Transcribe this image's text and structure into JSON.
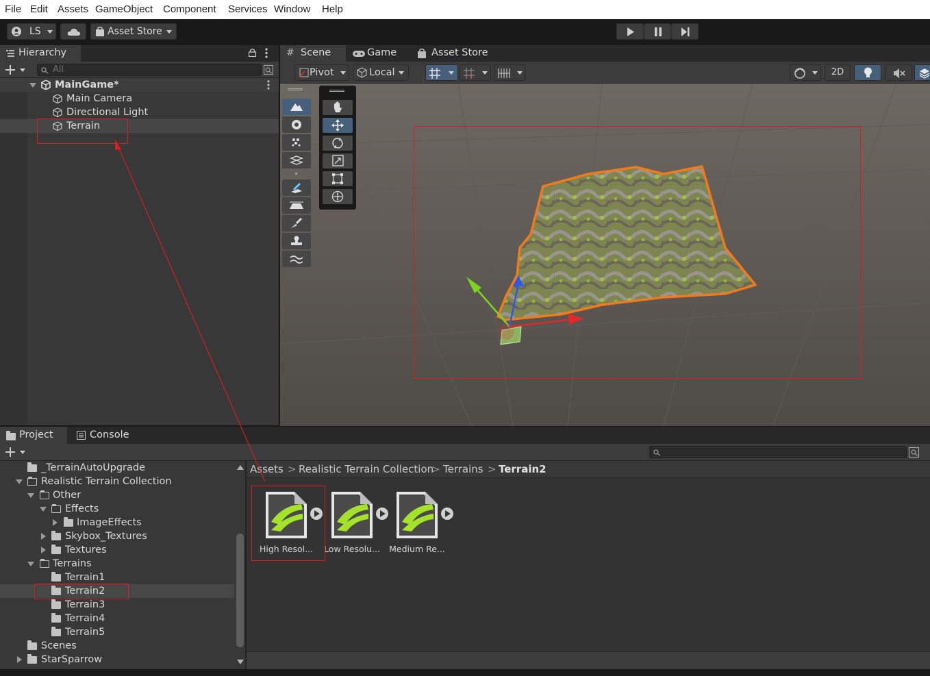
{
  "menu": [
    "File",
    "Edit",
    "Assets",
    "GameObject",
    "Component",
    "Services",
    "Window",
    "Help"
  ],
  "toolbar": {
    "account": "LS",
    "asset_store": "Asset Store"
  },
  "hierarchy": {
    "tab": "Hierarchy",
    "search_placeholder": "All",
    "scene": "MainGame*",
    "items": [
      "Main Camera",
      "Directional Light",
      "Terrain"
    ]
  },
  "scene_view": {
    "tabs": [
      "Scene",
      "Game",
      "Asset Store"
    ],
    "pivot": "Pivot",
    "local": "Local",
    "mode_2d": "2D"
  },
  "project": {
    "tabs": [
      "Project",
      "Console"
    ],
    "tree": [
      {
        "label": "_TerrainAutoUpgrade"
      },
      {
        "label": "Realistic Terrain Collection"
      },
      {
        "label": "Other"
      },
      {
        "label": "Effects"
      },
      {
        "label": "ImageEffects"
      },
      {
        "label": "Skybox_Textures"
      },
      {
        "label": "Textures"
      },
      {
        "label": "Terrains"
      },
      {
        "label": "Terrain1"
      },
      {
        "label": "Terrain2"
      },
      {
        "label": "Terrain3"
      },
      {
        "label": "Terrain4"
      },
      {
        "label": "Terrain5"
      },
      {
        "label": "Scenes"
      },
      {
        "label": "StarSparrow"
      }
    ],
    "breadcrumb": [
      "Assets",
      "Realistic Terrain Collection",
      "Terrains",
      "Terrain2"
    ],
    "assets": [
      "High Resol...",
      "Low Resolu...",
      "Medium Re..."
    ]
  },
  "colors": {
    "highlight": "#d81e1e",
    "terrain_outline": "#f07a1c",
    "selected_tool": "#46607c"
  }
}
